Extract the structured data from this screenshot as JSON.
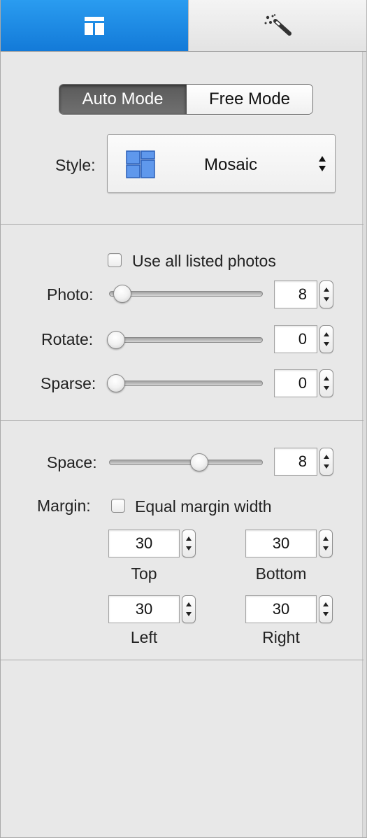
{
  "tabs": [
    {
      "name": "layout",
      "icon": "layout-icon",
      "active": true
    },
    {
      "name": "effects",
      "icon": "magic-wand-icon",
      "active": false
    }
  ],
  "mode": {
    "auto_label": "Auto Mode",
    "free_label": "Free Mode",
    "selected": "Auto Mode"
  },
  "style": {
    "label": "Style:",
    "value": "Mosaic",
    "icon": "mosaic-icon"
  },
  "photos": {
    "use_all_label": "Use all listed photos",
    "use_all_checked": false,
    "photo": {
      "label": "Photo:",
      "value": "8",
      "slider_level": 0.05
    },
    "rotate": {
      "label": "Rotate:",
      "value": "0",
      "slider_level": 0.0
    },
    "sparse": {
      "label": "Sparse:",
      "value": "0",
      "slider_level": 0.0
    }
  },
  "spacing": {
    "space": {
      "label": "Space:",
      "value": "8",
      "slider_level": 0.6
    },
    "margin_label": "Margin:",
    "equal_margin_label": "Equal margin width",
    "equal_margin_checked": false,
    "top": {
      "label": "Top",
      "value": "30"
    },
    "bottom": {
      "label": "Bottom",
      "value": "30"
    },
    "left": {
      "label": "Left",
      "value": "30"
    },
    "right": {
      "label": "Right",
      "value": "30"
    }
  },
  "colors": {
    "accent": "#1a87e3",
    "panel_bg": "#e8e8e8",
    "selected_segment": "#616161"
  }
}
